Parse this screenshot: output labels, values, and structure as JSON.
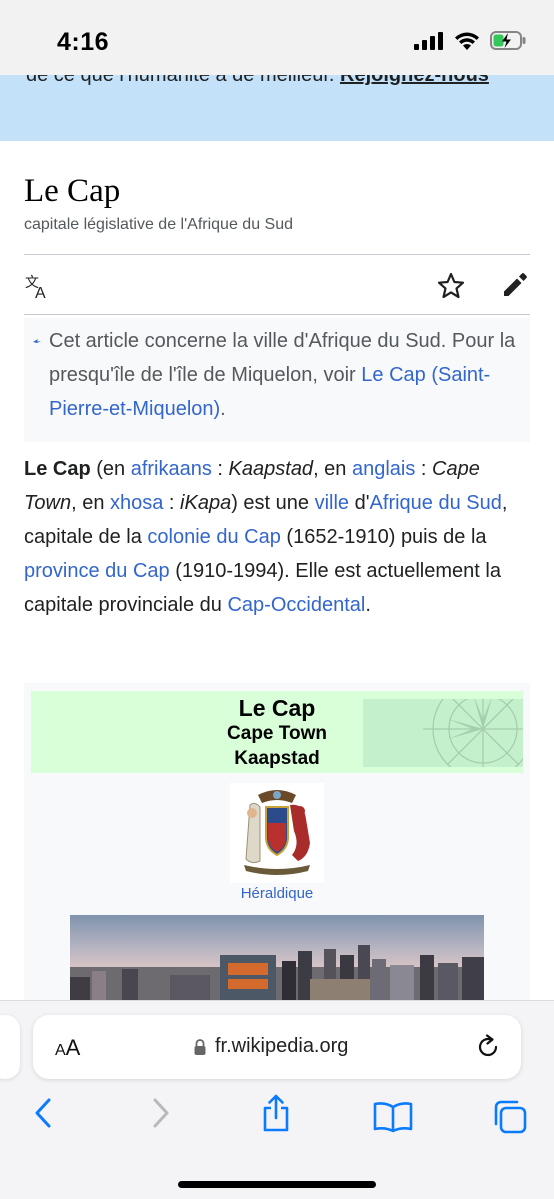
{
  "status": {
    "time": "4:16"
  },
  "banner": {
    "line1": "de ce que l'humanité a de meilleur. ",
    "link": "Rejoignez-nous"
  },
  "article": {
    "title": "Le Cap",
    "subtitle": "capitale législative de l'Afrique du Sud",
    "hatnote": {
      "text": "Cet article concerne la ville d'Afrique du Sud. Pour la presqu'île de l'île de Miquelon, voir ",
      "link": "Le Cap (Saint-Pierre-et-Miquelon)",
      "end": "."
    },
    "lead": {
      "bold": "Le Cap",
      "t1": " (en ",
      "l_afrikaans": "afrikaans",
      "t2": " : ",
      "i_kaapstad": "Kaapstad",
      "t3": ", en ",
      "l_anglais": "anglais",
      "t4": " : ",
      "i_capetown": "Cape Town",
      "t5": ", en ",
      "l_xhosa": "xhosa",
      "t6": " : ",
      "i_ikapa": "iKapa",
      "t7": ") est une ",
      "l_ville": "ville",
      "t8": " d'",
      "l_afrique": "Afrique du Sud",
      "t9": ", capitale de la ",
      "l_colonie": "colonie du Cap",
      "t10": " (1652-1910) puis de la ",
      "l_province": "province du Cap",
      "t11": " (1910-1994). Elle est actuellement la capitale provinciale du ",
      "l_capocc": "Cap-Occidental",
      "t12": "."
    }
  },
  "infobox": {
    "title": "Le Cap",
    "name_en": "Cape Town",
    "name_af": "Kaapstad",
    "emblem_caption": "Héraldique"
  },
  "browser": {
    "aa_label_small": "A",
    "aa_label": "A",
    "url": "fr.wikipedia.org"
  },
  "icons": {
    "language": "translate-icon",
    "watch": "star-icon",
    "edit": "pencil-icon"
  },
  "colors": {
    "link": "#3366cc",
    "banner_bg": "#c3e1f9",
    "infobox_head": "#d8ffd8",
    "ios_blue": "#0a7aff"
  }
}
